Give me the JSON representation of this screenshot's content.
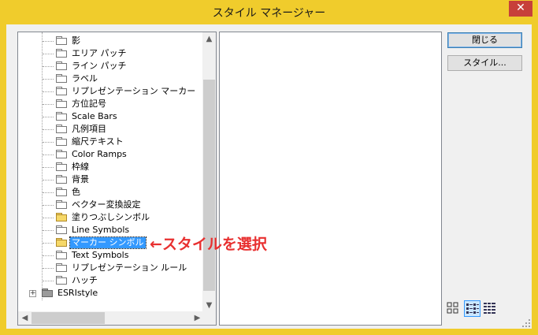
{
  "window": {
    "title": "スタイル マネージャー",
    "close_glyph": "✕"
  },
  "tree": {
    "items": [
      {
        "label": "影",
        "folder": "closed"
      },
      {
        "label": "エリア パッチ",
        "folder": "closed"
      },
      {
        "label": "ライン パッチ",
        "folder": "closed"
      },
      {
        "label": "ラベル",
        "folder": "closed"
      },
      {
        "label": "リプレゼンテーション マーカー",
        "folder": "closed"
      },
      {
        "label": "方位記号",
        "folder": "closed"
      },
      {
        "label": "Scale Bars",
        "folder": "closed"
      },
      {
        "label": "凡例項目",
        "folder": "closed"
      },
      {
        "label": "縮尺テキスト",
        "folder": "closed"
      },
      {
        "label": "Color Ramps",
        "folder": "closed"
      },
      {
        "label": "枠線",
        "folder": "closed"
      },
      {
        "label": "背景",
        "folder": "closed"
      },
      {
        "label": "色",
        "folder": "closed"
      },
      {
        "label": "ベクター変換設定",
        "folder": "closed"
      },
      {
        "label": "塗りつぶしシンボル",
        "folder": "open"
      },
      {
        "label": "Line Symbols",
        "folder": "closed"
      },
      {
        "label": "マーカー シンボル",
        "folder": "open",
        "selected": true
      },
      {
        "label": "Text Symbols",
        "folder": "closed"
      },
      {
        "label": "リプレゼンテーション ルール",
        "folder": "closed"
      },
      {
        "label": "ハッチ",
        "folder": "closed"
      }
    ],
    "root": {
      "label": "ESRIstyle",
      "expander": "+",
      "folder": "dark"
    }
  },
  "scroll": {
    "up": "▲",
    "down": "▼",
    "left": "◀",
    "right": "▶"
  },
  "buttons": {
    "close": "閉じる",
    "styles": "スタイル..."
  },
  "annotation": "←スタイルを選択",
  "colors": {
    "title_bar": "#f0cc2c",
    "close_button": "#c7403a",
    "selection": "#3399ff",
    "annotation": "#e83030"
  }
}
